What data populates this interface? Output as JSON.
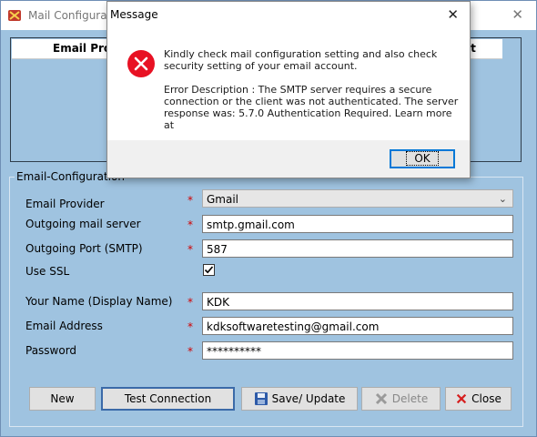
{
  "window": {
    "title": "Mail Configuratio",
    "close_glyph": "✕",
    "icon": "app-icon"
  },
  "grid": {
    "col_email_provider": "Email Pro",
    "col_default": "lt"
  },
  "group": {
    "legend": "Email-Configuration"
  },
  "form": {
    "provider_label": "Email Provider",
    "provider_value": "Gmail",
    "server_label": "Outgoing mail server",
    "server_value": "smtp.gmail.com",
    "port_label": "Outgoing Port (SMTP)",
    "port_value": "587",
    "ssl_label": "Use SSL",
    "ssl_checked": true,
    "name_label": "Your Name (Display Name)",
    "name_value": "KDK",
    "email_label": "Email Address",
    "email_value": "kdksoftwaretesting@gmail.com",
    "password_label": "Password",
    "password_value": "**********",
    "required_mark": "*"
  },
  "buttons": {
    "new": "New",
    "test": "Test Connection",
    "save": "Save/ Update",
    "delete": "Delete",
    "close": "Close"
  },
  "dialog": {
    "title": "Message",
    "close_glyph": "✕",
    "line1": "Kindly check mail configuration setting and also check security setting of your email account.",
    "line2": "Error Description : The SMTP server requires a secure connection or the client was not authenticated. The server response was: 5.7.0 Authentication Required. Learn more at",
    "ok": "OK",
    "icon": "error-icon"
  }
}
